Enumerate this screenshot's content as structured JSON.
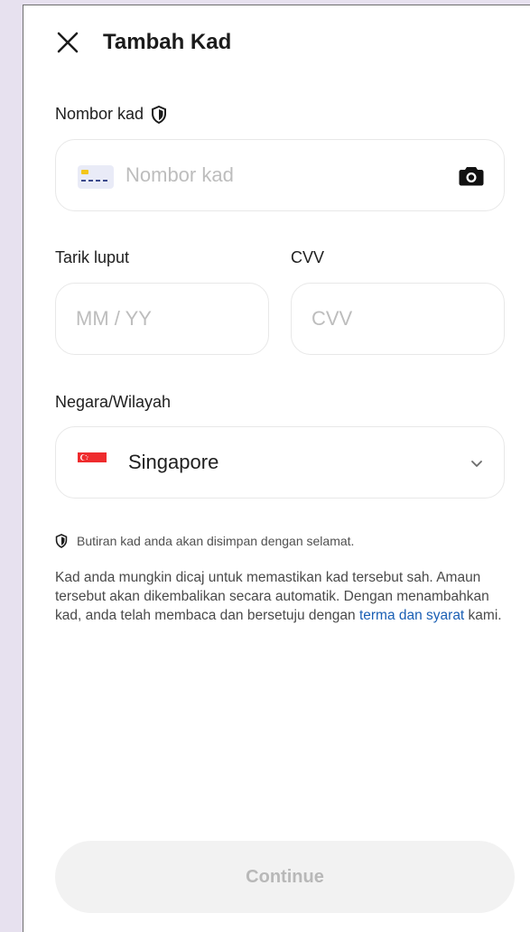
{
  "header": {
    "title": "Tambah Kad"
  },
  "card_number": {
    "label": "Nombor kad",
    "placeholder": "Nombor kad"
  },
  "expiry": {
    "label": "Tarik luput",
    "placeholder": "MM / YY"
  },
  "cvv": {
    "label": "CVV",
    "placeholder": "CVV"
  },
  "country": {
    "label": "Negara/Wilayah",
    "selected": "Singapore"
  },
  "security_note": "Butiran kad anda akan disimpan dengan selamat.",
  "disclaimer": {
    "text_before": "Kad anda mungkin dicaj untuk memastikan kad tersebut sah. Amaun tersebut akan dikembalikan secara automatik. Dengan menambahkan kad, anda telah membaca dan bersetuju dengan ",
    "link_text": "terma dan syarat",
    "text_after": " kami."
  },
  "continue_button": {
    "label": "Continue"
  },
  "icons": {
    "close": "close-icon",
    "shield": "shield-icon",
    "card": "card-icon",
    "camera": "camera-icon",
    "flag": "singapore-flag-icon",
    "chevron": "chevron-down-icon"
  },
  "colors": {
    "link": "#1a5fb4",
    "disabled_button_bg": "#f2f2f2",
    "disabled_button_text": "#b8b8b8",
    "background": "#e7e1ef"
  }
}
